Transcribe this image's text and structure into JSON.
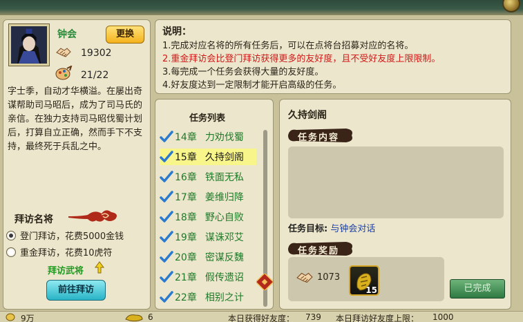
{
  "character": {
    "name": "钟会",
    "swap_label": "更换",
    "friendship_value": "19302",
    "visits_value": "21/22",
    "bio": "字士季，自动才华横溢。在屡出奇谋帮助司马昭后，成为了司马氏的亲信。在独力支持司马昭伐蜀计划后，打算自立正确，然而手下不支持，最终死于兵乱之中。"
  },
  "visit": {
    "title": "拜访名将",
    "options": [
      {
        "label": "登门拜访，花费5000金钱",
        "selected": true
      },
      {
        "label": "重金拜访，花费10虎符",
        "selected": false
      }
    ],
    "visit_general_link": "拜访武将",
    "go_button": "前往拜访"
  },
  "description": {
    "title": "说明：",
    "lines": [
      {
        "text": "1.完成对应名将的所有任务后，可以在点将台招募对应的名将。",
        "color": "#2a2418"
      },
      {
        "text": "2.重金拜访会比登门拜访获得更多的友好度，且不受好友度上限限制。",
        "color": "#d01818"
      },
      {
        "text": "3.每完成一个任务会获得大量的友好度。",
        "color": "#2a2418"
      },
      {
        "text": "4.好友度达到一定限制才能开启高级的任务。",
        "color": "#2a2418"
      }
    ]
  },
  "tasklist": {
    "title": "任务列表",
    "items": [
      {
        "chapter": "14章",
        "name": "力劝伐蜀",
        "selected": false
      },
      {
        "chapter": "15章",
        "name": "久持剑阁",
        "selected": true
      },
      {
        "chapter": "16章",
        "name": "铁面无私",
        "selected": false
      },
      {
        "chapter": "17章",
        "name": "姜维归降",
        "selected": false
      },
      {
        "chapter": "18章",
        "name": "野心自败",
        "selected": false
      },
      {
        "chapter": "19章",
        "name": "谋诛邓艾",
        "selected": false
      },
      {
        "chapter": "20章",
        "name": "密谋反魏",
        "selected": false
      },
      {
        "chapter": "21章",
        "name": "假传遗诏",
        "selected": false
      },
      {
        "chapter": "22章",
        "name": "相别之计",
        "selected": false
      }
    ]
  },
  "detail": {
    "task_name": "久持剑阁",
    "content_heading": "任务内容",
    "content_text": "",
    "target_label": "任务目标:",
    "target_link": "与钟会对话",
    "reward_heading": "任务奖励",
    "reward_friendship": "1073",
    "reward_item_count": "15",
    "done_button": "已完成"
  },
  "status_bar": {
    "money": "9万",
    "tiger_tally": "6",
    "today_friendship_label": "本日获得好友度：",
    "today_friendship_value": "739",
    "limit_label": "本日拜访好友度上限：",
    "limit_value": "1000"
  },
  "colors": {
    "panel_bg": "#ebe6cc",
    "green_text": "#1f7a28",
    "red_text": "#d01818",
    "link_blue": "#1a3ea8",
    "highlight": "#f8f58a"
  }
}
